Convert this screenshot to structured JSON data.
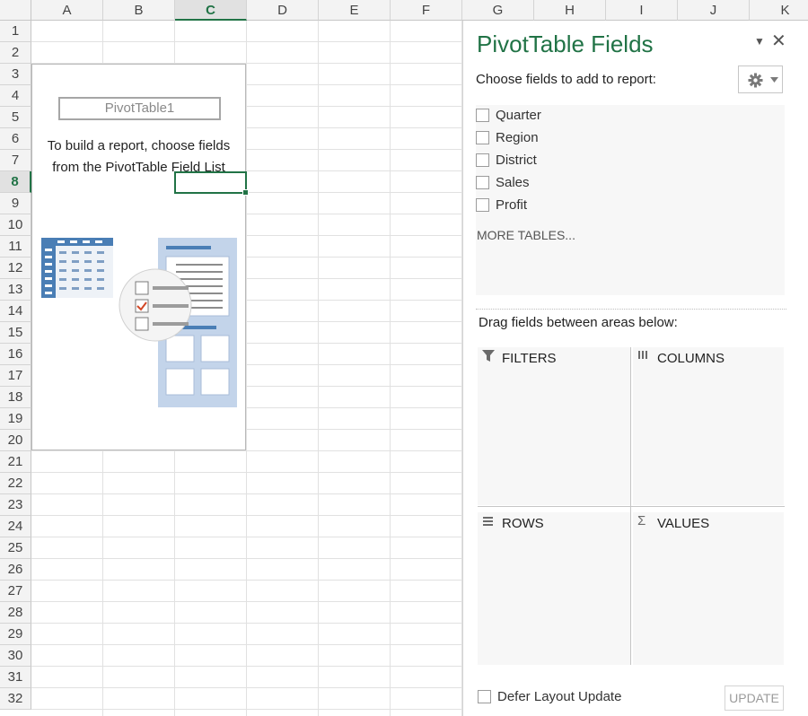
{
  "columns": [
    "A",
    "B",
    "C",
    "D",
    "E",
    "F",
    "G",
    "H",
    "I",
    "J",
    "K"
  ],
  "active_column": "C",
  "rows": [
    "1",
    "2",
    "3",
    "4",
    "5",
    "6",
    "7",
    "8",
    "9",
    "10",
    "11",
    "12",
    "13",
    "14",
    "15",
    "16",
    "17",
    "18",
    "19",
    "20",
    "21",
    "22",
    "23",
    "24",
    "25",
    "26",
    "27",
    "28",
    "29",
    "30",
    "31",
    "32"
  ],
  "active_row": "8",
  "pivot": {
    "name": "PivotTable1",
    "instruction_line1": "To build a report, choose fields",
    "instruction_line2": "from the PivotTable Field List"
  },
  "pane": {
    "title": "PivotTable Fields",
    "choose_label": "Choose fields to add to report:",
    "fields": [
      "Quarter",
      "Region",
      "District",
      "Sales",
      "Profit"
    ],
    "more_tables": "MORE TABLES...",
    "drag_label": "Drag fields between areas below:",
    "areas": {
      "filters": "FILTERS",
      "columns": "COLUMNS",
      "rows": "ROWS",
      "values": "VALUES"
    },
    "defer_label": "Defer Layout Update",
    "update_label": "UPDATE"
  },
  "colors": {
    "accent_green": "#217346",
    "illustration_blue": "#4a7eb5",
    "illustration_panel": "#c3d4ea"
  }
}
